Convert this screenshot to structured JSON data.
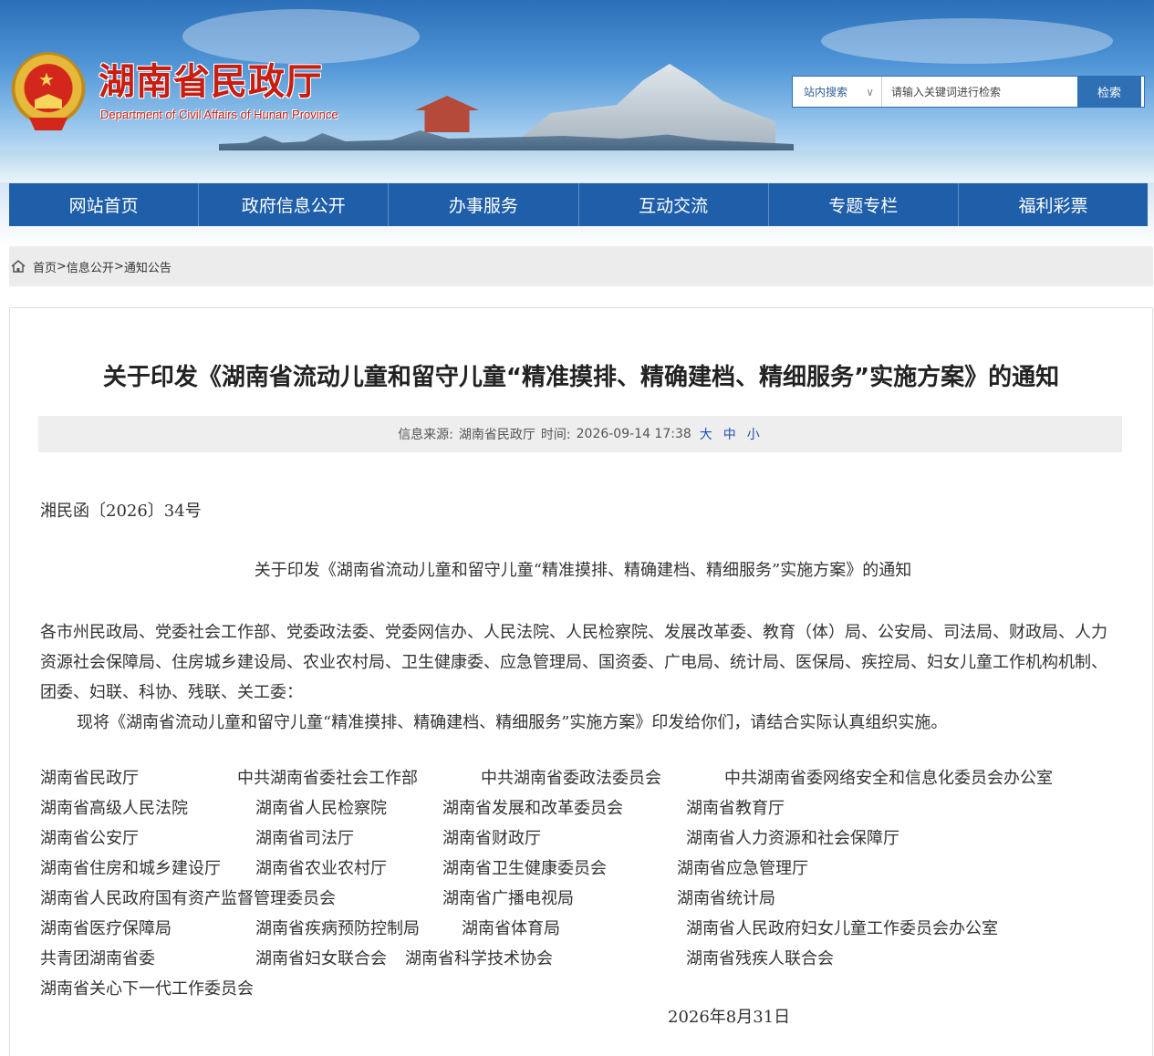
{
  "header": {
    "title": "湖南省民政厅",
    "subtitle": "Department of Civil Affairs of Hunan Province"
  },
  "search": {
    "scope": "站内搜索",
    "placeholder": "请输入关键词进行检索",
    "button": "检索"
  },
  "nav": [
    "网站首页",
    "政府信息公开",
    "办事服务",
    "互动交流",
    "专题专栏",
    "福利彩票"
  ],
  "breadcrumb": {
    "home": "首页",
    "sep": ">",
    "level1": "信息公开",
    "level2": "通知公告"
  },
  "article": {
    "title": "关于印发《湖南省流动儿童和留守儿童“精准摸排、精确建档、精细服务”实施方案》的通知",
    "source_label": "信息来源:",
    "source": "湖南省民政厅",
    "time_label": "时间:",
    "time": "2026-09-14 17:38",
    "size_large": "大",
    "size_medium": "中",
    "size_small": "小",
    "doc_number": "湘民函〔2026〕34号",
    "subject": "关于印发《湖南省流动儿童和留守儿童“精准摸排、精确建档、精细服务”实施方案》的通知",
    "recipients": "各市州民政局、党委社会工作部、党委政法委、党委网信办、人民法院、人民检察院、发展改革委、教育（体）局、公安局、司法局、财政局、人力资源社会保障局、住房城乡建设局、农业农村局、卫生健康委、应急管理局、国资委、广电局、统计局、医保局、疾控局、妇女儿童工作机构机制、团委、妇联、科协、残联、关工委：",
    "instruction": "现将《湖南省流动儿童和留守儿童“精准摸排、精确建档、精细服务”实施方案》印发给你们，请结合实际认真组织实施。",
    "signers": [
      "湖南省民政厅",
      "中共湖南省委社会工作部",
      "中共湖南省委政法委员会",
      "中共湖南省委网络安全和信息化委员会办公室",
      "湖南省高级人民法院",
      "湖南省人民检察院",
      "湖南省发展和改革委员会",
      "湖南省教育厅",
      "湖南省公安厅",
      "湖南省司法厅",
      "湖南省财政厅",
      "湖南省人力资源和社会保障厅",
      "湖南省住房和城乡建设厅",
      "湖南省农业农村厅",
      "湖南省卫生健康委员会",
      "湖南省应急管理厅",
      "湖南省人民政府国有资产监督管理委员会",
      "湖南省广播电视局",
      "湖南省统计局",
      "湖南省医疗保障局",
      "湖南省疾病预防控制局",
      "湖南省体育局",
      "湖南省人民政府妇女儿童工作委员会办公室",
      "共青团湖南省委",
      "湖南省妇女联合会",
      "湖南省科学技术协会",
      "湖南省残疾人联合会",
      "湖南省关心下一代工作委员会"
    ],
    "date": "2026年8月31日"
  }
}
